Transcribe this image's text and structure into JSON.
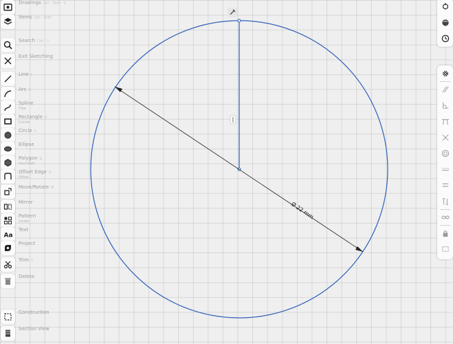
{
  "left_toolbar": [
    {
      "label": "Drawings",
      "sub": "",
      "key": "Ctrl · Shift · S",
      "icon": "drawings-icon"
    },
    {
      "label": "Items",
      "sub": "",
      "key": "Ctrl · Shift",
      "icon": "layers-icon"
    },
    {
      "label": "Search",
      "sub": "",
      "key": "Ctrl · ⇧",
      "icon": "search-icon"
    },
    {
      "label": "Exit Sketching",
      "sub": "",
      "key": "",
      "icon": "close-icon"
    },
    {
      "label": "Line",
      "sub": "",
      "key": "L",
      "icon": "line-icon"
    },
    {
      "label": "Arc",
      "sub": "",
      "key": "A",
      "icon": "arc-icon"
    },
    {
      "label": "Spline",
      "sub": "Free",
      "key": "",
      "icon": "spline-icon"
    },
    {
      "label": "Rectangle",
      "sub": "Corner",
      "key": "R",
      "icon": "rectangle-icon"
    },
    {
      "label": "Circle",
      "sub": "",
      "key": "C",
      "icon": "circle-icon"
    },
    {
      "label": "Ellipse",
      "sub": "",
      "key": "",
      "icon": "ellipse-icon"
    },
    {
      "label": "Polygon",
      "sub": "Inscribed",
      "key": "G",
      "icon": "polygon-icon"
    },
    {
      "label": "Offset Edge",
      "sub": "Offset",
      "key": "O",
      "icon": "offset-edge-icon"
    },
    {
      "label": "Move/Rotate",
      "sub": "",
      "key": "M",
      "icon": "move-rotate-icon"
    },
    {
      "label": "Mirror",
      "sub": "",
      "key": "",
      "icon": "mirror-icon"
    },
    {
      "label": "Pattern",
      "sub": "Linear",
      "key": "",
      "icon": "pattern-icon"
    },
    {
      "label": "Text",
      "sub": "",
      "key": "",
      "icon": "text-icon"
    },
    {
      "label": "Project",
      "sub": "",
      "key": "",
      "icon": "project-icon"
    },
    {
      "label": "Trim",
      "sub": "",
      "key": "T",
      "icon": "trim-icon"
    },
    {
      "label": "Delete",
      "sub": "",
      "key": "",
      "icon": "trash-icon"
    },
    {
      "label": "Construction",
      "sub": "",
      "key": "",
      "icon": "construction-icon"
    },
    {
      "label": "Section View",
      "sub": "",
      "key": "",
      "icon": "section-view-icon"
    }
  ],
  "right_top": [
    "cube-axes-icon",
    "render-sphere-icon",
    "history-clock-icon"
  ],
  "right_constraints": [
    "settings-gear-icon",
    "parallel-icon",
    "perpendicular-icon",
    "horizontal-vertical-icon",
    "coincident-icon",
    "concentric-icon",
    "tangent-icon",
    "equal-icon",
    "symmetric-icon",
    "fix-link-icon",
    "lock-icon",
    "dimension-bounds-icon"
  ],
  "dimension": {
    "text": "Ø 22 mm"
  },
  "colors": {
    "sketch_line": "#2e5fb8",
    "dimension": "#222222",
    "background": "#efefef",
    "grid": "#d4d4d4"
  }
}
